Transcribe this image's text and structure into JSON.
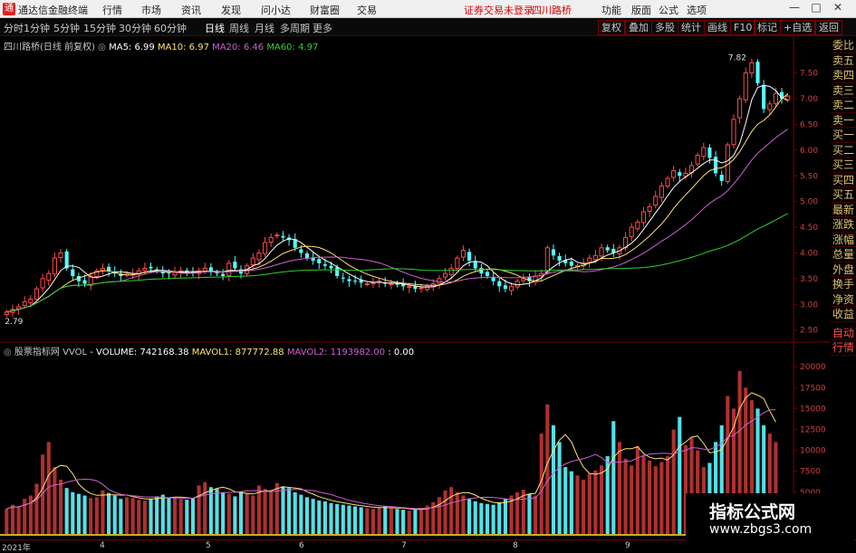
{
  "app": {
    "title": "通达信金融终端",
    "notice": "证券交易未登录",
    "stock_tab": "四川路桥"
  },
  "menu": [
    "行情",
    "市场",
    "资讯",
    "发现",
    "问小达",
    "财富圈",
    "交易"
  ],
  "right_menu": [
    "功能",
    "版面",
    "公式",
    "选项"
  ],
  "window_controls": [
    "—",
    "□",
    "✕"
  ],
  "periods": [
    "分时",
    "1分钟",
    "5分钟",
    "15分钟",
    "30分钟",
    "60分钟",
    "日线",
    "周线",
    "月线",
    "多周期",
    "更多"
  ],
  "active_period": "日线",
  "tool_buttons": [
    "复权",
    "叠加",
    "多股",
    "统计",
    "画线",
    "F10",
    "标记",
    "+自选",
    "返回"
  ],
  "price_legend": {
    "name": "四川路桥(日线 前复权)",
    "ma5": "MA5: 6.99",
    "ma10": "MA10: 6.97",
    "ma20": "MA20: 6.46",
    "ma60": "MA60: 4.97"
  },
  "vol_legend": {
    "name": "股票指标网 VVOL",
    "volume": "- VOLUME: 742168.38",
    "mavol1": "MAVOL1: 877772.88",
    "mavol2": "MAVOL2: 1193982.00",
    "tail": ": 0.00"
  },
  "price_axis_ticks": [
    "7.50",
    "7.00",
    "6.50",
    "6.00",
    "5.50",
    "5.00",
    "4.50",
    "4.00",
    "3.50",
    "3.00",
    "2.50"
  ],
  "volume_axis_ticks": [
    "20000",
    "17500",
    "15000",
    "12500",
    "10000",
    "7500",
    "5000"
  ],
  "annotations": {
    "high": "7.82",
    "low": "2.79"
  },
  "side_panel": [
    "委比",
    "卖五",
    "卖四",
    "卖三",
    "卖二",
    "卖一",
    "买一",
    "买二",
    "买三",
    "买四",
    "买五",
    "最新",
    "涨跌",
    "涨幅",
    "总量",
    "外盘",
    "换手",
    "净资",
    "收益",
    "自动",
    "行情"
  ],
  "date_axis": [
    "2021年",
    "4",
    "5",
    "6",
    "7",
    "8",
    "9"
  ],
  "watermark": {
    "line1": "指标公式网",
    "line2": "www.zbgs3.com"
  },
  "colors": {
    "up": "#ff4a4a",
    "down": "#54ffff",
    "ma5": "#ffffff",
    "ma10": "#ffe170",
    "ma20": "#d060d0",
    "ma60": "#30d030",
    "grid": "#7a0000"
  },
  "chart_data": {
    "type": "candlestick",
    "title": "四川路桥(日线 前复权)",
    "price_ylim": [
      2.3,
      7.9
    ],
    "closes": [
      2.85,
      2.9,
      2.95,
      3.05,
      3.1,
      3.3,
      3.5,
      3.6,
      3.9,
      4.0,
      3.7,
      3.55,
      3.45,
      3.4,
      3.55,
      3.65,
      3.7,
      3.65,
      3.6,
      3.55,
      3.6,
      3.6,
      3.65,
      3.7,
      3.7,
      3.65,
      3.6,
      3.6,
      3.62,
      3.65,
      3.6,
      3.62,
      3.65,
      3.7,
      3.65,
      3.6,
      3.55,
      3.8,
      3.7,
      3.6,
      3.75,
      3.9,
      4.0,
      4.2,
      4.3,
      4.35,
      4.3,
      4.25,
      4.1,
      4.0,
      3.9,
      3.85,
      3.8,
      3.75,
      3.7,
      3.55,
      3.5,
      3.45,
      3.45,
      3.42,
      3.4,
      3.42,
      3.45,
      3.4,
      3.4,
      3.38,
      3.35,
      3.35,
      3.3,
      3.32,
      3.35,
      3.4,
      3.5,
      3.6,
      3.7,
      3.9,
      4.05,
      3.85,
      3.7,
      3.6,
      3.55,
      3.45,
      3.35,
      3.3,
      3.35,
      3.45,
      3.5,
      3.45,
      3.55,
      3.6,
      4.1,
      3.95,
      3.85,
      3.8,
      3.75,
      3.75,
      3.8,
      3.9,
      3.95,
      4.1,
      4.05,
      4.0,
      4.1,
      4.3,
      4.5,
      4.6,
      4.8,
      4.9,
      5.1,
      5.3,
      5.45,
      5.6,
      5.5,
      5.55,
      5.7,
      5.9,
      6.05,
      5.85,
      5.55,
      5.4,
      6.1,
      6.6,
      7.0,
      7.5,
      7.7,
      7.3,
      6.8,
      6.9,
      7.1,
      7.0,
      7.05
    ],
    "volumes": [
      3000,
      3500,
      3200,
      4200,
      4600,
      6000,
      9500,
      11000,
      8000,
      6500,
      5500,
      5000,
      4800,
      4600,
      4300,
      4400,
      5200,
      4900,
      4600,
      4200,
      4400,
      4300,
      4100,
      4000,
      4200,
      4500,
      4700,
      4300,
      4400,
      4200,
      4100,
      4300,
      5800,
      6200,
      5600,
      5400,
      5000,
      4800,
      4500,
      5100,
      4900,
      4600,
      5800,
      5400,
      5200,
      6100,
      5700,
      5500,
      5000,
      4700,
      4400,
      4200,
      4000,
      3900,
      3700,
      3600,
      3500,
      3400,
      3300,
      3200,
      3100,
      3000,
      3200,
      3300,
      3100,
      3000,
      2900,
      2800,
      2900,
      3100,
      3400,
      3800,
      4400,
      5200,
      5600,
      5000,
      4600,
      4200,
      3900,
      3700,
      3600,
      3500,
      3800,
      4200,
      4600,
      5000,
      5300,
      4800,
      4600,
      12000,
      15500,
      13000,
      11000,
      8000,
      7500,
      7000,
      6500,
      7200,
      7600,
      8200,
      9300,
      13500,
      11000,
      9000,
      8200,
      10500,
      9400,
      8800,
      8100,
      8600,
      9300,
      12500,
      14000,
      10600,
      11500,
      10000,
      8000,
      8500,
      11000,
      13000,
      16500,
      15000,
      19500,
      17500,
      16000,
      15000,
      13000,
      12000,
      11000
    ],
    "vol_ylim": [
      0,
      21000
    ],
    "ma5": 6.99,
    "ma10": 6.97,
    "ma20": 6.46,
    "ma60": 4.97,
    "x_labels": [
      "2021年",
      "4",
      "5",
      "6",
      "7",
      "8",
      "9"
    ]
  }
}
